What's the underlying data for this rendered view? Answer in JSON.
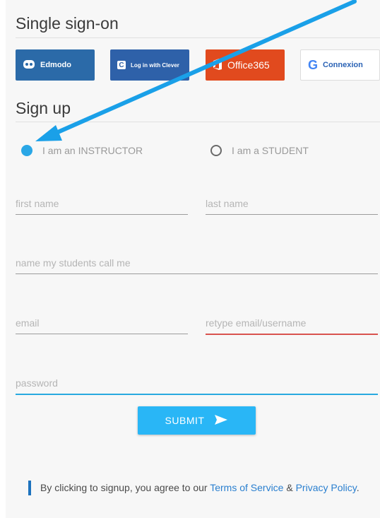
{
  "sso": {
    "title": "Single sign-on",
    "providers": [
      {
        "label": "Edmodo"
      },
      {
        "label": "Log in with Clever"
      },
      {
        "label": "Office365"
      },
      {
        "label": "Connexion"
      }
    ]
  },
  "signup": {
    "title": "Sign up",
    "role_options": [
      {
        "label": "I am an INSTRUCTOR",
        "checked": true
      },
      {
        "label": "I am a STUDENT",
        "checked": false
      }
    ],
    "fields": {
      "first_name": "first name",
      "last_name": "last name",
      "display_name": "name my students call me",
      "email": "email",
      "retype_email": "retype email/username",
      "password": "password"
    },
    "submit_label": "SUBMIT"
  },
  "legal": {
    "prefix": "By clicking to signup, you agree to our ",
    "terms": "Terms of Service",
    "amp": " & ",
    "privacy": "Privacy Policy",
    "suffix": "."
  },
  "colors": {
    "accent": "#29b6f6",
    "error": "#d9534f",
    "office": "#e14a1e",
    "edmodo": "#2b6aa8"
  }
}
